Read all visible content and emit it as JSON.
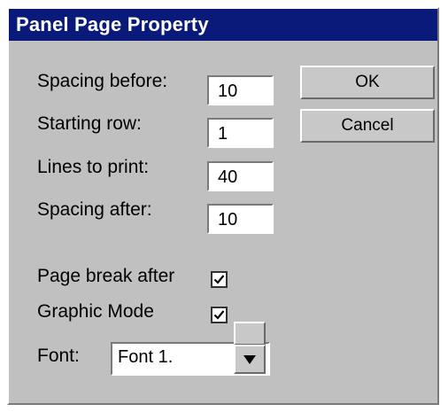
{
  "dialog": {
    "title": "Panel Page Property"
  },
  "fields": {
    "spacing_before": {
      "label": "Spacing before:",
      "value": "10"
    },
    "starting_row": {
      "label": "Starting row:",
      "value": "1"
    },
    "lines_to_print": {
      "label": "Lines to print:",
      "value": "40"
    },
    "spacing_after": {
      "label": "Spacing after:",
      "value": "10"
    }
  },
  "buttons": {
    "ok": "OK",
    "cancel": "Cancel"
  },
  "options": {
    "page_break_after": {
      "label": "Page break after",
      "checked": true
    },
    "graphic_mode": {
      "label": "Graphic Mode",
      "checked": true
    }
  },
  "font": {
    "label": "Font:",
    "selected": "Font 1."
  },
  "icons": {
    "checkbox_mark": "checkmark-icon",
    "dropdown": "chevron-down-icon"
  },
  "colors": {
    "titlebar": "#0a1a7a",
    "dialog_bg": "#c0c0c0"
  }
}
